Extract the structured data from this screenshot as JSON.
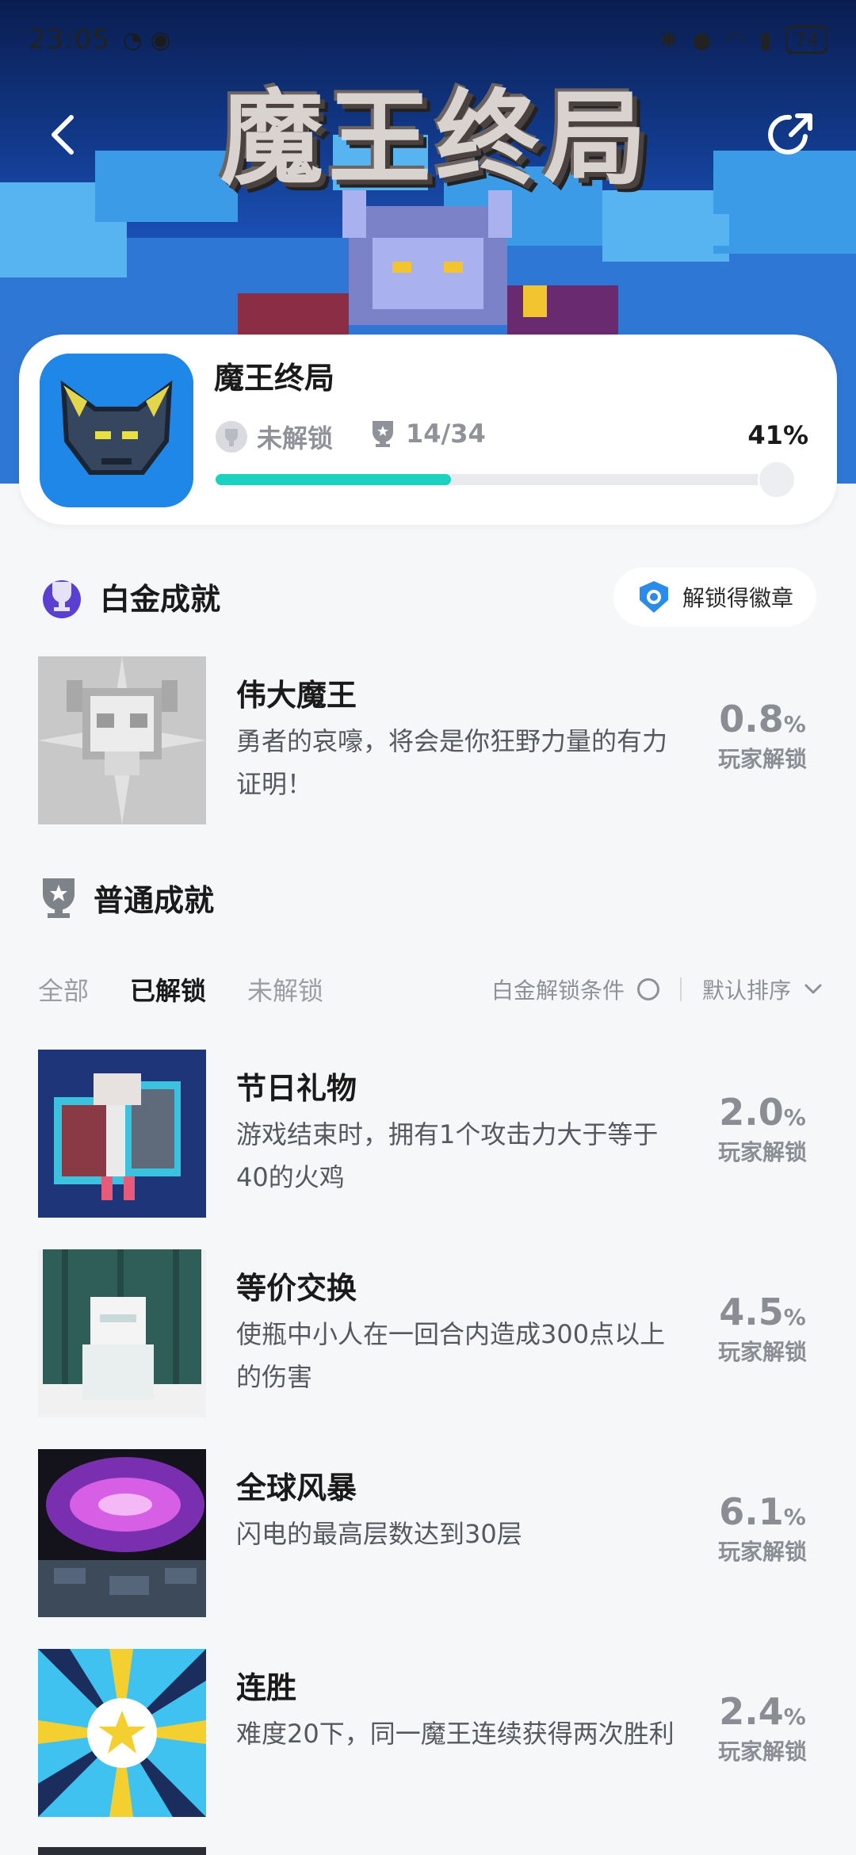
{
  "status_bar": {
    "time": "23:05",
    "battery": "74"
  },
  "header": {
    "logo_text": "魔王终局"
  },
  "game": {
    "name": "魔王终局",
    "unlock_status": "未解锁",
    "trophy_count": "14/34",
    "progress_percent": "41%",
    "progress_fraction": 0.41,
    "accent_color": "#19d3c0"
  },
  "platinum": {
    "section_title": "白金成就",
    "badge_button_label": "解锁得徽章",
    "achievement": {
      "title": "伟大魔王",
      "description": "勇者的哀嚎，将会是你狂野力量的有力证明！",
      "rate": "0.8",
      "unit": "%",
      "label": "玩家解锁"
    }
  },
  "normal": {
    "section_title": "普通成就",
    "tabs": [
      "全部",
      "已解锁",
      "未解锁"
    ],
    "active_tab": "已解锁",
    "condition_label": "白金解锁条件",
    "sort_label": "默认排序",
    "achievements": [
      {
        "title": "节日礼物",
        "description": "游戏结束时，拥有1个攻击力大于等于40的火鸡",
        "rate": "2.0",
        "unit": "%",
        "label": "玩家解锁"
      },
      {
        "title": "等价交换",
        "description": "使瓶中小人在一回合内造成300点以上的伤害",
        "rate": "4.5",
        "unit": "%",
        "label": "玩家解锁"
      },
      {
        "title": "全球风暴",
        "description": "闪电的最高层数达到30层",
        "rate": "6.1",
        "unit": "%",
        "label": "玩家解锁"
      },
      {
        "title": "连胜",
        "description": "难度20下，同一魔王连续获得两次胜利",
        "rate": "2.4",
        "unit": "%",
        "label": "玩家解锁"
      }
    ]
  }
}
